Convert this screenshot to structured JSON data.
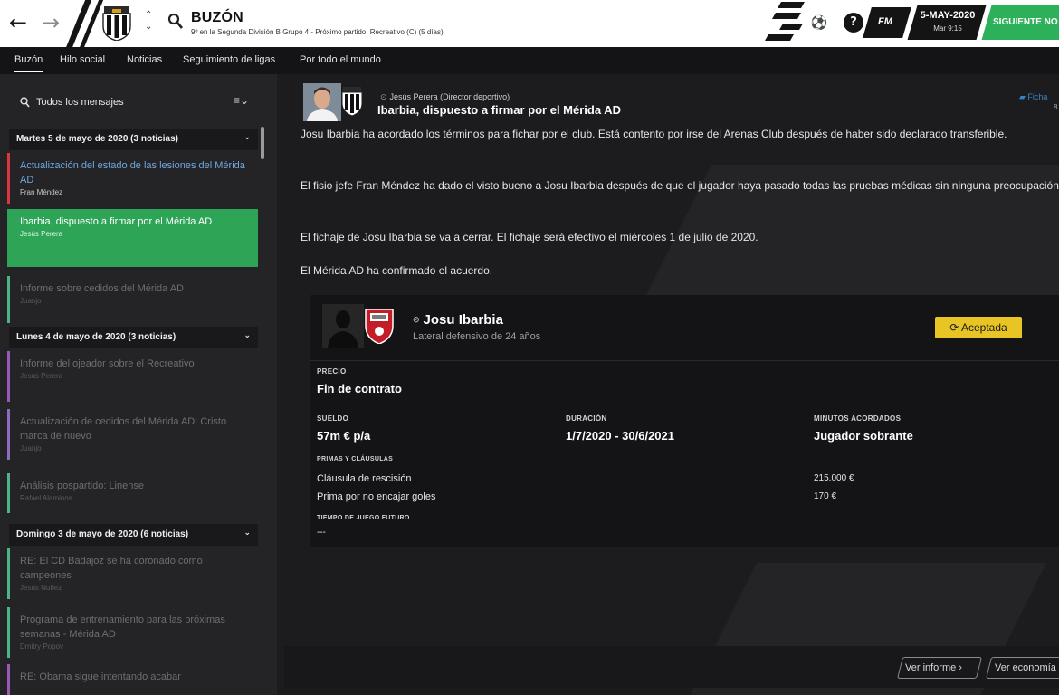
{
  "header": {
    "title": "BUZÓN",
    "subtitle": "9º en la Segunda División B Grupo 4 - Próximo partido: Recreativo (C) (5 días)",
    "fm_label": "FM",
    "date": "5-MAY-2020",
    "time": "Mar 9:15",
    "continue_label": "SIGUIENTE NO LE"
  },
  "tabs": [
    {
      "label": "Buzón",
      "active": true
    },
    {
      "label": "Hilo social"
    },
    {
      "label": "Noticias"
    },
    {
      "label": "Seguimiento de ligas"
    },
    {
      "label": "Por todo el mundo"
    }
  ],
  "sidebar": {
    "filter_label": "Todos los mensajes",
    "groups": [
      {
        "header": "Martes 5 de mayo de 2020 (3 noticias)",
        "messages": [
          {
            "title": "Actualización del estado de las lesiones del Mérida AD",
            "from": "Fran Méndez",
            "state": "unread",
            "accent": "#d9363e"
          },
          {
            "title": "Ibarbia, dispuesto a firmar por el Mérida AD",
            "from": "Jesús Perera",
            "state": "selected",
            "accent": "#2ea556"
          },
          {
            "title": "Informe sobre cedidos del Mérida AD",
            "from": "Juanjo",
            "state": "read",
            "accent": "#4fb38a"
          }
        ]
      },
      {
        "header": "Lunes 4 de mayo de 2020 (3 noticias)",
        "messages": [
          {
            "title": "Informe del ojeador sobre el Recreativo",
            "from": "Jesús Perera",
            "state": "read",
            "accent": "#9b59b6"
          },
          {
            "title": "Actualización de cedidos del Mérida AD: Cristo marca de nuevo",
            "from": "Juanjo",
            "state": "read",
            "accent": "#8e6bc1"
          },
          {
            "title": "Análisis pospartido: Linense",
            "from": "Rafael Alaminos",
            "state": "read",
            "accent": "#4fb38a"
          }
        ]
      },
      {
        "header": "Domingo 3 de mayo de 2020 (6 noticias)",
        "messages": [
          {
            "title": "RE: El CD Badajoz se ha coronado como campeones",
            "from": "Jesús Nuñez",
            "state": "read",
            "accent": "#4fb38a"
          },
          {
            "title": "Programa de entrenamiento para las próximas semanas - Mérida AD",
            "from": "Dmitry Popov",
            "state": "read",
            "accent": "#4fb38a"
          },
          {
            "title": "RE: Obama sigue intentando acabar",
            "from": "",
            "state": "read",
            "accent": "#9b59b6"
          }
        ]
      }
    ]
  },
  "message": {
    "sender": "Jesús Perera (Director deportivo)",
    "subject": "Ibarbia, dispuesto a firmar por el Mérida AD",
    "report_link": "Ficha",
    "report_sub": "8",
    "paragraphs": [
      "Josu Ibarbia ha acordado los términos para fichar por el club. Está contento por irse del Arenas Club después de haber sido declarado transferible.",
      "El fisio jefe Fran Méndez ha dado el visto bueno a Josu Ibarbia después de que el jugador haya pasado todas las pruebas médicas sin ninguna preocupación.",
      "El fichaje de Josu Ibarbia se va a cerrar. El fichaje será efectivo el miércoles 1 de julio de 2020.",
      "El Mérida AD ha confirmado el acuerdo."
    ]
  },
  "contract": {
    "player_name": "Josu Ibarbia",
    "player_desc": "Lateral defensivo de 24 años",
    "status": "Aceptada",
    "price_label": "PRECIO",
    "price_value": "Fin de contrato",
    "wage_label": "SUELDO",
    "wage_value": "57m € p/a",
    "duration_label": "DURACIÓN",
    "duration_value": "1/7/2020 - 30/6/2021",
    "minutes_label": "MINUTOS ACORDADOS",
    "minutes_value": "Jugador sobrante",
    "clauses_label": "PRIMAS Y CLÁUSULAS",
    "clauses": [
      {
        "name": "Cláusula de rescisión",
        "value": "215.000 €"
      },
      {
        "name": "Prima por no encajar goles",
        "value": "170 €"
      }
    ],
    "future_label": "TIEMPO DE JUEGO FUTURO",
    "future_value": "---"
  },
  "footer": {
    "report_button": "Ver informe ›",
    "economy_button": "Ver economía"
  },
  "colors": {
    "accent_green": "#2ea556",
    "status_yellow": "#e8c524",
    "link_blue": "#3b82c4"
  }
}
